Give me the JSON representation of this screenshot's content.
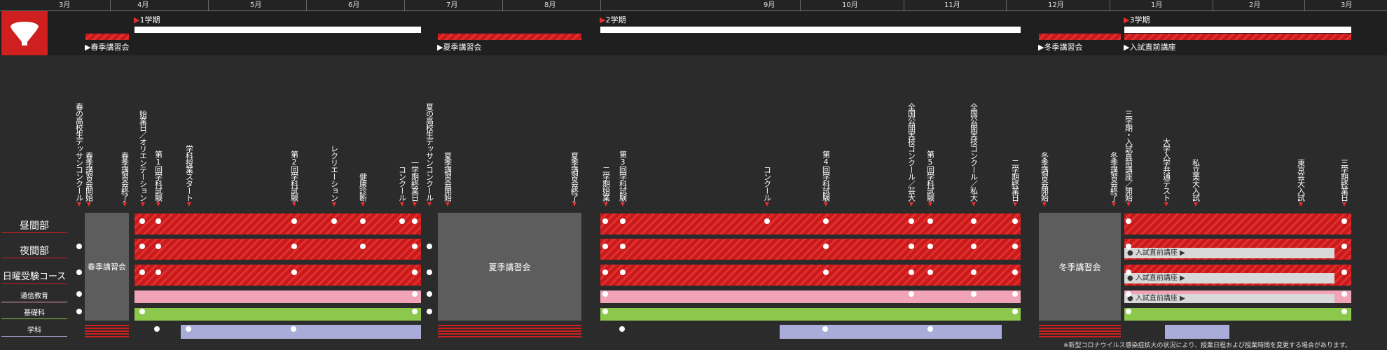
{
  "months": [
    "3月",
    "4月",
    "5月",
    "6月",
    "7月",
    "8月",
    "9月",
    "10月",
    "11月",
    "12月",
    "1月",
    "2月",
    "3月"
  ],
  "terms": [
    {
      "label": "1学期"
    },
    {
      "label": "2学期"
    },
    {
      "label": "3学期"
    }
  ],
  "lectures": [
    {
      "label": "春季講習会"
    },
    {
      "label": "夏季講習会"
    },
    {
      "label": "冬季講習会"
    },
    {
      "label": "入試直前講座"
    }
  ],
  "events": [
    "春の高校生デッサンコンクール",
    "春季講習会開始",
    "春季講習会終了",
    "始業日／オリエンテーション",
    "第1回学科試験",
    "学科授業スタート",
    "第2回学科試験",
    "レクリエーション",
    "健康診断",
    "一学期終業日",
    "コンクール",
    "夏の高校生デッサンコンクール",
    "夏季講習会開始",
    "夏季講習会終了",
    "二学期始業",
    "第3回学科試験",
    "コンクール",
    "第4回学科試験",
    "全国公開実技コンクール／芸大",
    "第5回学科試験",
    "全国公開実技コンクール／私大",
    "二学期終業日",
    "冬季講習会開始",
    "冬季講習会終了",
    "三学期・入試直前講座／開始",
    "大学入学共通テスト",
    "私立美大入試",
    "東京芸大入試",
    "三学期終業日"
  ],
  "rows": [
    {
      "label": "昼間部",
      "underline": "#cf1f1f"
    },
    {
      "label": "夜間部",
      "underline": "#cf1f1f"
    },
    {
      "label": "日曜受験コース",
      "underline": "#cf1f1f"
    },
    {
      "label": "通信教育",
      "underline": "#f1a4b8"
    },
    {
      "label": "基礎科",
      "underline": "#8cc84b"
    },
    {
      "label": "学科",
      "underline": "#a9acd8"
    }
  ],
  "break_blocks": [
    "春季講習会",
    "夏季講習会",
    "冬季講習会"
  ],
  "exam_prep_label": "入試直前講座",
  "footnote": "※新型コロナウイルス感染症拡大の状況により、授業日程および授業時間を変更する場合があります。",
  "colors": {
    "accent": "#cf1f1f",
    "pink": "#f1a4b8",
    "green": "#8cc84b",
    "lavender": "#a9acd8",
    "gray": "#5d5d5d"
  }
}
